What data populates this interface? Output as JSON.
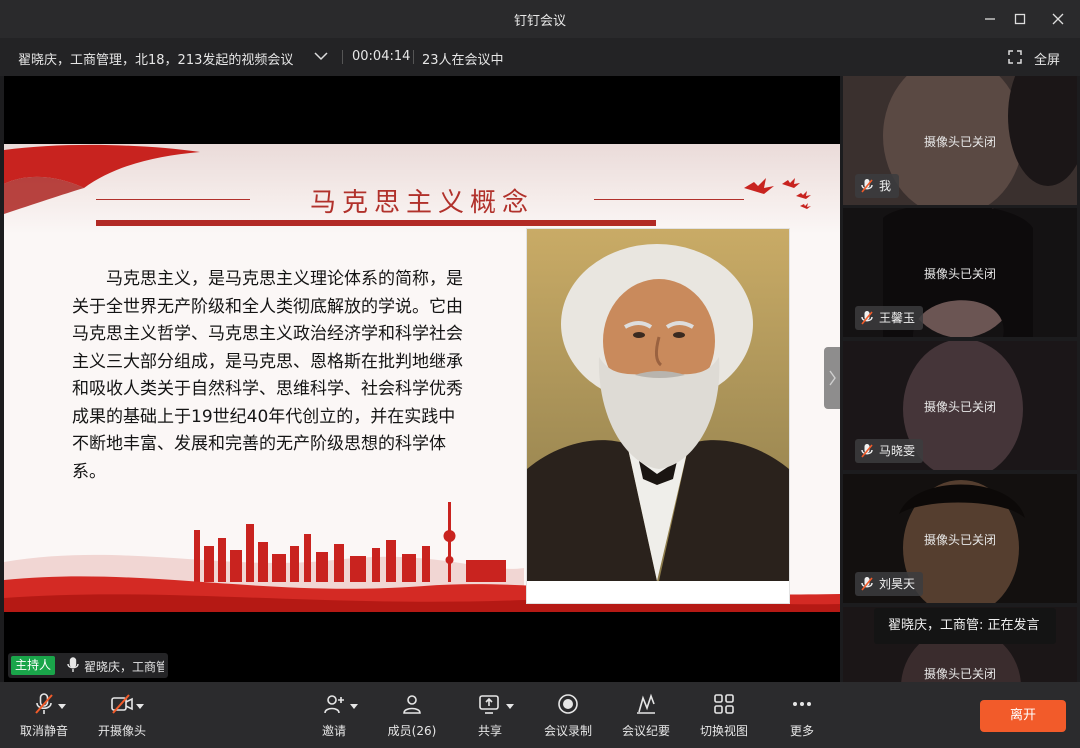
{
  "window": {
    "title": "钉钉会议"
  },
  "infobar": {
    "meeting_title": "翟晓庆，工商管理，北18，213发起的视频会议",
    "elapsed": "00:04:14",
    "participants_in_meeting": "23人在会议中",
    "fullscreen_label": "全屏"
  },
  "slide": {
    "title": "马克思主义概念",
    "body": "马克思主义，是马克思主义理论体系的简称，是关于全世界无产阶级和全人类彻底解放的学说。它由马克思主义哲学、马克思主义政治经济学和科学社会主义三大部分组成，是马克思、恩格斯在批判地继承和吸收人类关于自然科学、思维科学、社会科学优秀成果的基础上于19世纪40年代创立的，并在实践中不断地丰富、发展和完善的无产阶级思想的科学体系。"
  },
  "host": {
    "badge": "主持人",
    "name": "翟晓庆，工商管"
  },
  "participants": [
    {
      "name": "我",
      "status": "摄像头已关闭"
    },
    {
      "name": "王馨玉",
      "status": "摄像头已关闭"
    },
    {
      "name": "马晓雯",
      "status": "摄像头已关闭"
    },
    {
      "name": "刘昊天",
      "status": "摄像头已关闭"
    },
    {
      "name": "",
      "status": "摄像头已关闭"
    }
  ],
  "speaking_tooltip": "翟晓庆，工商管: 正在发言",
  "toolbar": {
    "unmute": "取消静音",
    "camera_on": "开摄像头",
    "invite": "邀请",
    "members": "成员(26)",
    "share": "共享",
    "record": "会议录制",
    "minutes": "会议纪要",
    "switch_view": "切换视图",
    "more": "更多",
    "leave": "离开"
  },
  "colors": {
    "accent_red": "#b1312b",
    "leave_button": "#f25b2a",
    "host_badge": "#1aa54a"
  }
}
